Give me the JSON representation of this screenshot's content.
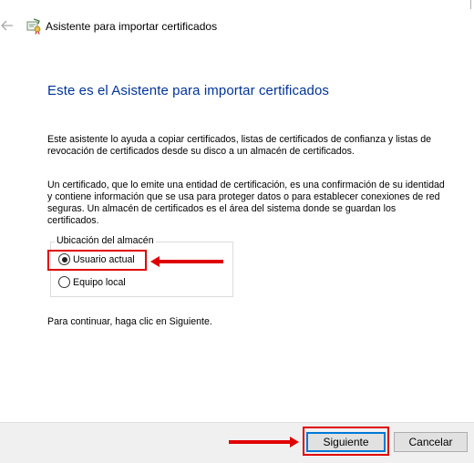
{
  "window": {
    "title": "Asistente para importar certificados",
    "back_icon": "back-arrow-icon",
    "title_icon": "certificate-icon"
  },
  "main": {
    "heading": "Este es el Asistente para importar certificados",
    "paragraph1": "Este asistente lo ayuda a copiar certificados, listas de certificados de confianza y listas de revocación de certificados desde su disco a un almacén de certificados.",
    "paragraph2": "Un certificado, que lo emite una entidad de certificación, es una confirmación de su identidad y contiene información que se usa para proteger datos o para establecer conexiones de red seguras. Un almacén de certificados es el área del sistema donde se guardan los certificados.",
    "store_location": {
      "legend": "Ubicación del almacén",
      "options": [
        {
          "label": "Usuario actual",
          "checked": true
        },
        {
          "label": "Equipo local",
          "checked": false
        }
      ]
    },
    "continue_text": "Para continuar, haga clic en Siguiente."
  },
  "footer": {
    "next_label": "Siguiente",
    "cancel_label": "Cancelar"
  },
  "colors": {
    "heading": "#003399",
    "annotation": "#e00000",
    "footer_bg": "#f0f0f0",
    "default_button_border": "#0078d7"
  }
}
